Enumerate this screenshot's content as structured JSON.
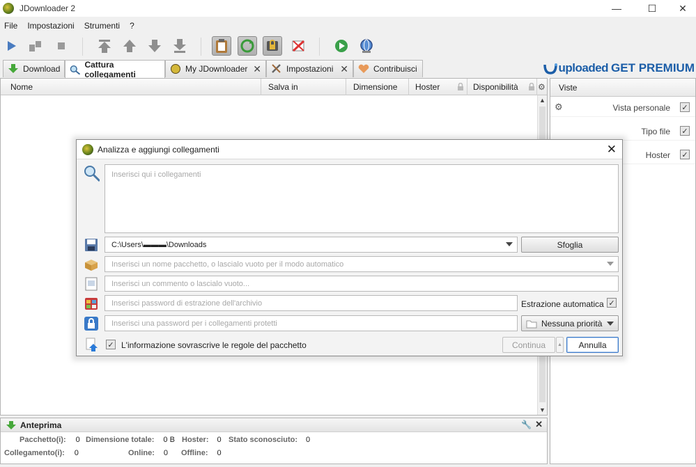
{
  "window": {
    "title": "JDownloader 2",
    "minimize": "—",
    "maximize": "☐",
    "close": "✕"
  },
  "menu": [
    "File",
    "Impostazioni",
    "Strumenti",
    "?"
  ],
  "tabs": [
    {
      "label": "Download",
      "icon": "download-arrow-icon"
    },
    {
      "label": "Cattura collegamenti",
      "icon": "link-grabber-icon"
    },
    {
      "label": "My JDownloader",
      "icon": "my-jdownloader-icon"
    },
    {
      "label": "Impostazioni",
      "icon": "settings-tools-icon"
    },
    {
      "label": "Contribuisci",
      "icon": "heart-icon"
    }
  ],
  "promo": {
    "brand": "uploaded",
    "cta": "GET PREMIUM"
  },
  "columns": [
    "Nome",
    "Salva in",
    "Dimensione",
    "Hoster",
    "Disponibilità"
  ],
  "views": {
    "header": "Viste",
    "items": [
      {
        "label": "Vista personale",
        "checked": true
      },
      {
        "label": "Tipo file",
        "checked": true
      },
      {
        "label": "Hoster",
        "checked": true
      }
    ]
  },
  "preview": {
    "title": "Anteprima",
    "stats": {
      "pacchetti_label": "Pacchetto(i):",
      "pacchetti": "0",
      "dimensione_label": "Dimensione totale:",
      "dimensione": "0 B",
      "hoster_label": "Hoster:",
      "hoster": "0",
      "stato_label": "Stato sconosciuto:",
      "stato": "0",
      "collegamenti_label": "Collegamento(i):",
      "collegamenti": "0",
      "online_label": "Online:",
      "online": "0",
      "offline_label": "Offline:",
      "offline": "0"
    }
  },
  "dialog": {
    "title": "Analizza e aggiungi collegamenti",
    "links_placeholder": "Inserisci qui i collegamenti",
    "save_path": "C:\\Users\\▬▬▬\\Downloads",
    "browse_label": "Sfoglia",
    "package_placeholder": "Inserisci un nome pacchetto, o lascialo vuoto per il modo automatico",
    "comment_placeholder": "Inserisci un commento o lascialo vuoto...",
    "extract_password_placeholder": "Inserisci password di estrazione dell'archivio",
    "auto_extract_label": "Estrazione automatica",
    "auto_extract_checked": true,
    "link_password_placeholder": "Inserisci una password per i collegamenti protetti",
    "priority_label": "Nessuna priorità",
    "overwrite_label": "L'informazione sovrascrive le regole del pacchetto",
    "overwrite_checked": true,
    "continue_label": "Continua",
    "cancel_label": "Annulla"
  }
}
